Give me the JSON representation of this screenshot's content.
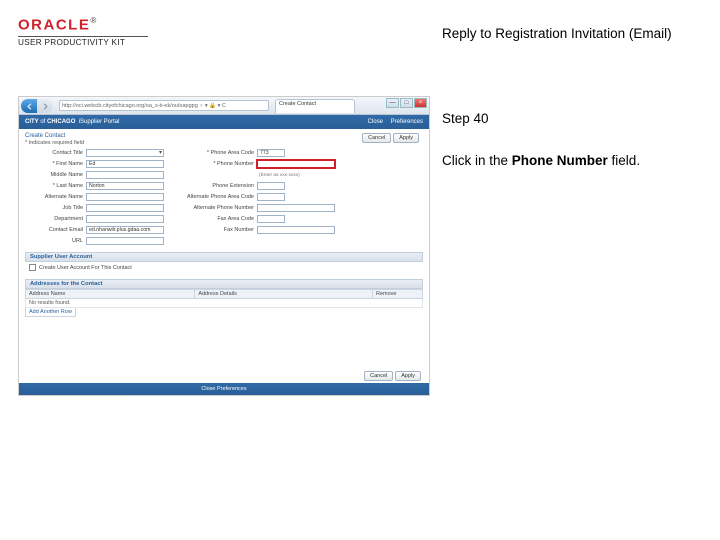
{
  "logo": {
    "brand": "ORACLE",
    "reg": "®",
    "sub": "USER PRODUCTIVITY KIT"
  },
  "page_title": "Reply to Registration Invitation (Email)",
  "step_label": "Step 40",
  "instruction": {
    "pre": "Click in the ",
    "bold": "Phone Number",
    "post": " field."
  },
  "browser": {
    "url": "http://oci.webcib.cityofchicago.org/oa_s-b-ek/ou/oapgpg ♀ ▾ 🔒 ▾ C",
    "tab": "Create Contact",
    "win": {
      "min": "—",
      "max": "□",
      "close": "×"
    }
  },
  "app": {
    "brand_city": "CITY",
    "brand_of": "of",
    "brand_chi": "CHICAGO",
    "portal": "iSupplier Portal",
    "link_close": "Close",
    "link_pref": "Preferences"
  },
  "form": {
    "crumb": "Create Contact",
    "req_note": "* Indicates required field",
    "btn_cancel": "Cancel",
    "btn_apply": "Apply",
    "left": {
      "contact_title": "Contact Title",
      "first_name": "* First Name",
      "middle_name": "Middle Name",
      "last_name": "* Last Name",
      "alt_name": "Alternate Name",
      "job_title": "Job Title",
      "dept": "Department",
      "email": "Contact Email",
      "url": "URL",
      "val_first": "Ed",
      "val_last": "Norton",
      "val_email": "ed.nhanwilr.plus.gdaa.com"
    },
    "right": {
      "area_code": "* Phone Area Code",
      "phone": "* Phone Number",
      "ext": "Phone Extension",
      "alt_area": "Alternate Phone Area Code",
      "alt_phone": "Alternate Phone Number",
      "fax_area": "Fax Area Code",
      "fax": "Fax Number",
      "val_area": "773",
      "hint": "(Enter as xxx-xxxx)"
    }
  },
  "sections": {
    "s1": "Supplier User Account",
    "chk": "Create User Account For This Contact",
    "s2": "Addresses for the Contact"
  },
  "table": {
    "h1": "Address Name",
    "h2": "Address Details",
    "h3": "Remove",
    "empty": "No results found.",
    "addrow": "Add Another Row"
  },
  "footer_txt": "Close   Preferences"
}
